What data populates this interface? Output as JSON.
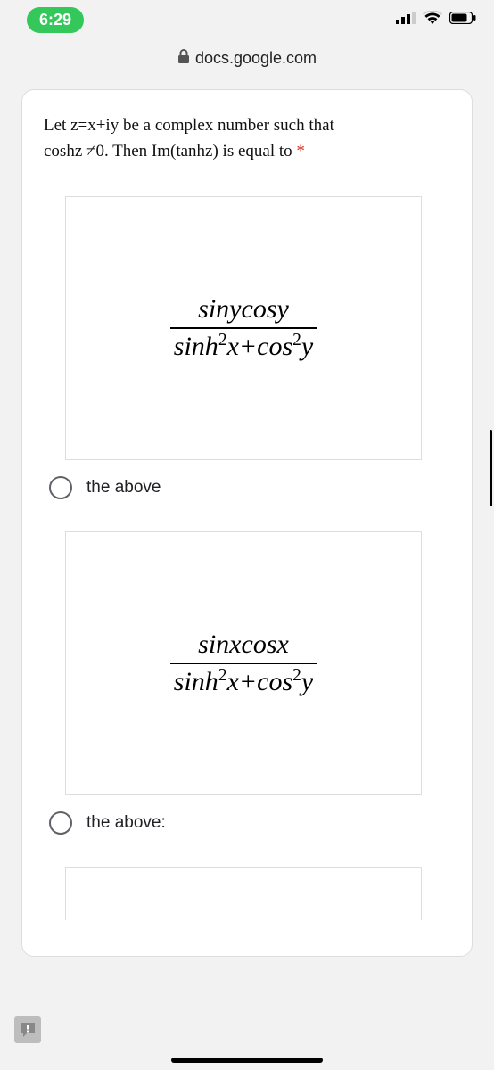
{
  "status": {
    "time": "6:29"
  },
  "browser": {
    "domain": "docs.google.com"
  },
  "question": {
    "line1": "Let z=x+iy be a complex number such that",
    "line2_prefix": "coshz ≠0. Then Im(tanhz) is equal to ",
    "required": "*"
  },
  "options": [
    {
      "numerator": "sinycosy",
      "den_a": "sinh",
      "den_b": "x+cos",
      "den_c": "y",
      "label": "the above"
    },
    {
      "numerator": "sinxcosx",
      "den_a": "sinh",
      "den_b": "x+cos",
      "den_c": "y",
      "label": "the above:"
    }
  ],
  "feedback": {
    "glyph": "!"
  }
}
